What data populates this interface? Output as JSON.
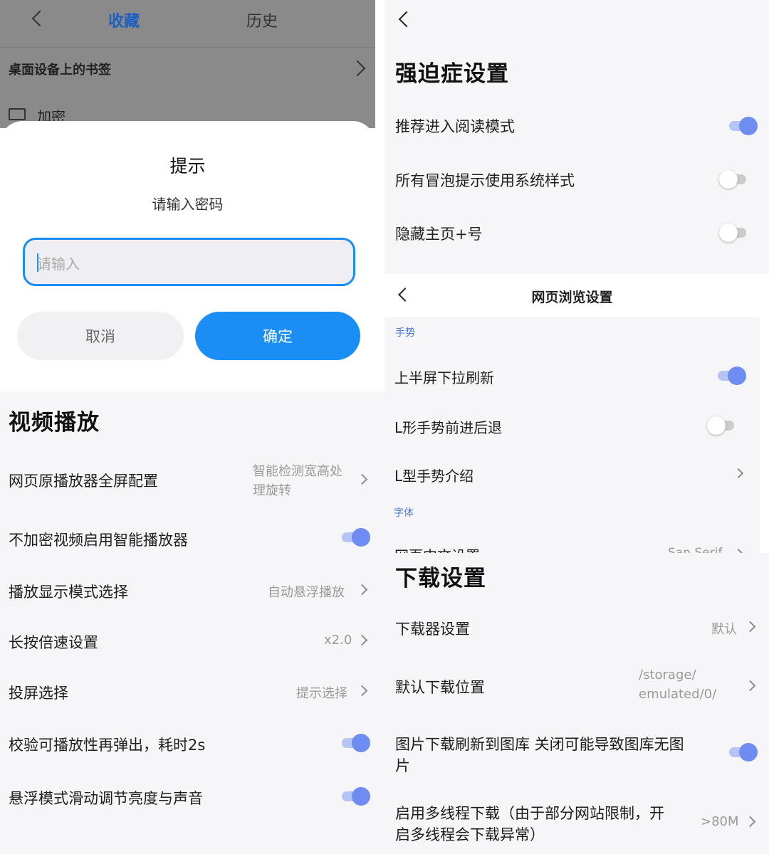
{
  "bookmarks": {
    "tabs": [
      "收藏",
      "历史"
    ],
    "folder_header": "桌面设备上的书签",
    "folder_item": "加密"
  },
  "dialog": {
    "title": "提示",
    "message": "请输入密码",
    "input_placeholder": "请输入",
    "cancel_label": "取消",
    "confirm_label": "确定"
  },
  "video": {
    "title": "视频播放",
    "items": [
      {
        "label": "网页原播放器全屏配置",
        "value_line1": "智能检测宽高处",
        "value_line2": "理旋转"
      },
      {
        "label": "不加密视频启用智能播放器",
        "toggle": true
      },
      {
        "label": "播放显示模式选择",
        "value": "自动悬浮播放"
      },
      {
        "label": "长按倍速设置",
        "value": "x2.0"
      },
      {
        "label": "投屏选择",
        "value": "提示选择"
      },
      {
        "label": "校验可播放性再弹出，耗时2s",
        "toggle": true
      },
      {
        "label": "悬浮模式滑动调节亮度与声音",
        "toggle": true
      }
    ]
  },
  "ocd": {
    "title": "强迫症设置",
    "items": [
      {
        "label": "推荐进入阅读模式",
        "toggle": true
      },
      {
        "label": "所有冒泡提示使用系统样式",
        "toggle": false
      },
      {
        "label": "隐藏主页+号",
        "toggle": false
      }
    ]
  },
  "browse": {
    "title": "网页浏览设置",
    "section_gesture": "手势",
    "items": [
      {
        "label": "上半屏下拉刷新",
        "toggle": true
      },
      {
        "label": "L形手势前进后退",
        "toggle": false
      },
      {
        "label": "L型手势介绍"
      }
    ],
    "section_font": "字体",
    "font_item_label": "网页中文设置",
    "font_item_value": "San Serif"
  },
  "download": {
    "title": "下载设置",
    "items": [
      {
        "label": "下载器设置",
        "value": "默认"
      },
      {
        "label": "默认下载位置",
        "value_line1": "/storage/",
        "value_line2": "emulated/0/"
      },
      {
        "label_line1": "图片下载刷新到图库 关闭可能导致图库无图",
        "label_line2": "片",
        "toggle": true
      },
      {
        "label_line1": "启用多线程下载（由于部分网站限制，开",
        "label_line2": "启多线程会下载异常）",
        "value": ">80M"
      }
    ]
  },
  "colors": {
    "accent_blue": "#1a8ef5",
    "toggle_on": "#6f8cf2",
    "section_blue": "#4a7bd8"
  }
}
